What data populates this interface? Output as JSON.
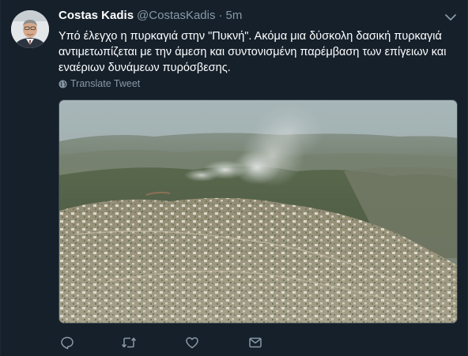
{
  "tweet": {
    "author_name": "Costas Kadis",
    "author_handle": "@CostasKadis",
    "separator": "·",
    "time": "5m",
    "text_lines": [
      "Υπό έλεγχο η πυρκαγιά στην \"Πυκνή\". Ακόμα μια δύσκολη δασική πυρκαγιά",
      "αντιμετωπίζεται με την άμεση και συντονισμένη παρέμβαση των επίγειων και",
      "εναέριων δυνάμεων πυρόσβεσης."
    ],
    "translate_label": "Translate Tweet"
  },
  "icons": {
    "menu": "chevron-down-icon",
    "translate": "globe-icon",
    "reply": "reply-icon",
    "retweet": "retweet-icon",
    "like": "heart-icon",
    "dm": "envelope-icon"
  },
  "colors": {
    "background": "#15202b",
    "primary_text": "#ffffff",
    "secondary_text": "#8899a6",
    "border": "#38444d"
  }
}
